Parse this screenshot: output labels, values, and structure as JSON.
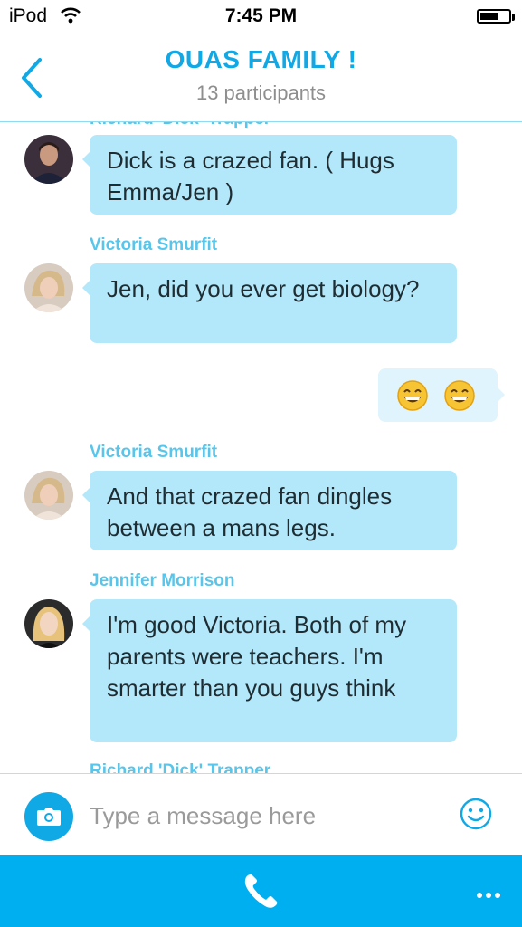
{
  "status_bar": {
    "carrier": "iPod",
    "time": "7:45 PM",
    "battery_level": 0.65
  },
  "header": {
    "title": "OUAS FAMILY !",
    "subtitle": "13 participants"
  },
  "messages": [
    {
      "sender": "Richard 'Dick' Trapper",
      "text": "Dick is a crazed fan. ( Hugs Emma/Jen )",
      "avatar": "avatar-richard"
    },
    {
      "sender": "Victoria Smurfit",
      "text": "Jen, did you ever get biology?",
      "avatar": "avatar-victoria"
    },
    {
      "outgoing": true,
      "emoji": [
        "grinning-face-emoji",
        "grinning-face-emoji"
      ]
    },
    {
      "sender": "Victoria Smurfit",
      "text": "And that crazed fan dingles between a mans legs.",
      "avatar": "avatar-victoria"
    },
    {
      "sender": "Jennifer Morrison",
      "text": "I'm good Victoria. Both of my parents were teachers. I'm smarter than you guys think",
      "avatar": "avatar-jennifer"
    },
    {
      "sender": "Richard 'Dick' Trapper"
    }
  ],
  "composer": {
    "placeholder": "Type a message here",
    "value": ""
  },
  "colors": {
    "accent": "#00aff0",
    "title": "#11a8e6",
    "bubble_in": "#b3e8fa",
    "bubble_out": "#dff4fc",
    "sender_name": "#58c5ea"
  },
  "icons": [
    "wifi-icon",
    "battery-icon",
    "back-chevron-icon",
    "camera-icon",
    "emoticon-icon",
    "phone-icon",
    "more-icon"
  ]
}
